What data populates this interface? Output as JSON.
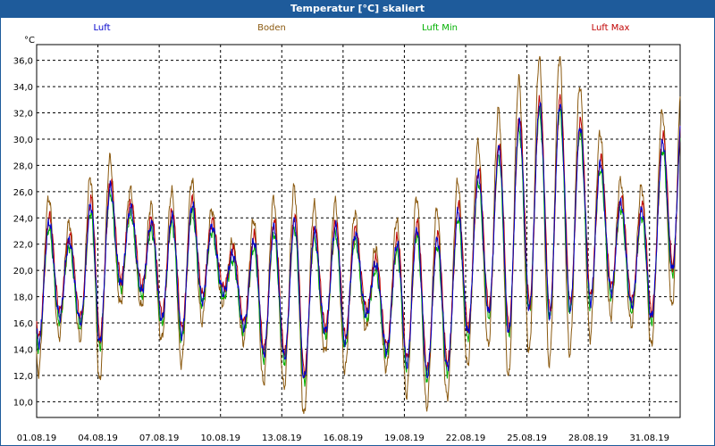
{
  "window": {
    "title": "Temperatur [°C] skaliert"
  },
  "chart_data": {
    "type": "line",
    "title": "Temperatur [°C] skaliert",
    "ylabel": "°C",
    "xlabel": "",
    "grid": true,
    "legend_position": "top",
    "ylim": [
      8.8,
      37.2
    ],
    "y_ticks": [
      "10,0",
      "12,0",
      "14,0",
      "16,0",
      "18,0",
      "20,0",
      "22,0",
      "24,0",
      "26,0",
      "28,0",
      "30,0",
      "32,0",
      "34,0",
      "36,0"
    ],
    "x_tick_labels": [
      "01.08.19",
      "04.08.19",
      "07.08.19",
      "10.08.19",
      "13.08.19",
      "16.08.19",
      "19.08.19",
      "22.08.19",
      "25.08.19",
      "28.08.19",
      "31.08.19"
    ],
    "x_range_days": [
      0,
      31.5
    ],
    "daily": {
      "min": [
        14.2,
        16.5,
        16.4,
        13.9,
        19.0,
        18.7,
        16.5,
        14.8,
        17.6,
        18.6,
        16.0,
        13.6,
        13.6,
        11.3,
        15.5,
        14.2,
        17.0,
        14.0,
        13.0,
        12.0,
        12.3,
        15.0,
        17.0,
        15.0,
        17.2,
        16.5,
        17.0,
        17.5,
        18.5,
        17.5,
        16.0,
        20.0
      ],
      "max": [
        24.0,
        23.5,
        21.5,
        27.0,
        26.0,
        24.0,
        23.3,
        24.6,
        25.2,
        22.2,
        20.6,
        23.2,
        23.4,
        24.0,
        22.2,
        24.0,
        22.0,
        19.5,
        23.5,
        23.0,
        22.0,
        26.0,
        28.0,
        30.0,
        32.0,
        33.0,
        32.5,
        30.0,
        27.0,
        24.0,
        25.0,
        32.5
      ]
    },
    "series": [
      {
        "name": "Luft",
        "color": "#0000cc",
        "mean_offset": 0.0,
        "amp_scale": 1.0,
        "phase": 0.0
      },
      {
        "name": "Boden",
        "color": "#8b5a10",
        "mean_offset": 0.0,
        "amp_scale": 1.45,
        "phase": 0.02
      },
      {
        "name": "Luft Min",
        "color": "#00b000",
        "mean_offset": -0.4,
        "amp_scale": 0.98,
        "phase": 0.01
      },
      {
        "name": "Luft Max",
        "color": "#c00000",
        "mean_offset": 0.4,
        "amp_scale": 1.0,
        "phase": -0.01
      }
    ]
  }
}
